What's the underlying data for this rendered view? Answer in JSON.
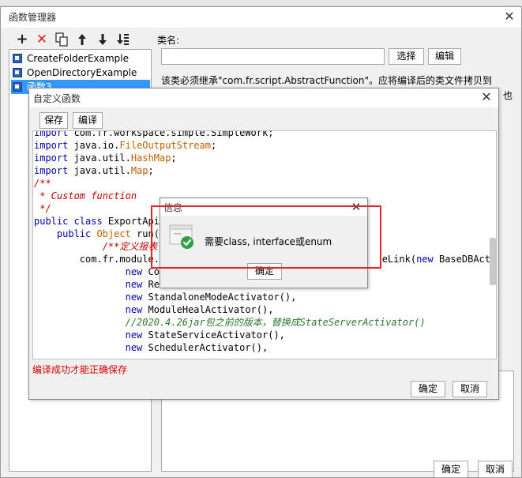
{
  "main": {
    "title": "函数管理器",
    "toolbar_icons": [
      "add-icon",
      "delete-icon",
      "copy-icon",
      "move-up-icon",
      "move-down-icon",
      "sort-icon"
    ],
    "list_items": [
      "CreateFolderExample",
      "OpenDirectoryExample",
      "函数3"
    ],
    "class_label": "类名:",
    "class_value": "",
    "select_label": "选择",
    "edit_label": "编辑",
    "description": "该类必须继承\"com.fr.script.AbstractFunction\"。应将编译后的类文件拷贝到",
    "description_tail": "也",
    "ok_label": "确定",
    "cancel_label": "取消"
  },
  "custom": {
    "title": "自定义函数",
    "save_label": "保存",
    "compile_label": "编译",
    "code_lines": [
      {
        "parts": [
          [
            "kw",
            "import"
          ],
          [
            "",
            " com.fr.workspace.simple.SimpleWork;"
          ]
        ]
      },
      {
        "parts": [
          [
            "kw",
            "import"
          ],
          [
            "",
            " java.io."
          ],
          [
            "cls",
            "FileOutputStream"
          ],
          [
            "",
            ";"
          ]
        ]
      },
      {
        "parts": [
          [
            "kw",
            "import"
          ],
          [
            "",
            " java.util."
          ],
          [
            "cls",
            "HashMap"
          ],
          [
            "",
            ";"
          ]
        ]
      },
      {
        "parts": [
          [
            "kw",
            "import"
          ],
          [
            "",
            " java.util."
          ],
          [
            "cls",
            "Map"
          ],
          [
            "",
            ";"
          ]
        ]
      },
      {
        "parts": [
          [
            "cm",
            "/**"
          ]
        ]
      },
      {
        "parts": [
          [
            "cm",
            " * Custom function"
          ]
        ]
      },
      {
        "parts": [
          [
            "cm",
            " */"
          ]
        ]
      },
      {
        "parts": [
          [
            "kw",
            "public class"
          ],
          [
            "",
            " ExportApi"
          ]
        ]
      },
      {
        "parts": [
          [
            "",
            "    "
          ],
          [
            "kw",
            "public"
          ],
          [
            "",
            " "
          ],
          [
            "cls",
            "Object"
          ],
          [
            "",
            " run("
          ],
          [
            "cls",
            "O"
          ]
        ]
      },
      {
        "parts": [
          [
            "",
            "            "
          ],
          [
            "cm",
            "/**定义报表"
          ]
        ]
      },
      {
        "parts": [
          [
            "",
            "        com.fr.module.M"
          ],
          [
            "",
            "                                      eLink("
          ],
          [
            "nw",
            "new"
          ],
          [
            "",
            " BaseDBActiva"
          ]
        ]
      },
      {
        "parts": [
          [
            "",
            "                "
          ],
          [
            "nw",
            "new"
          ],
          [
            "",
            " Con"
          ]
        ]
      },
      {
        "parts": [
          [
            "",
            "                "
          ],
          [
            "nw",
            "new"
          ],
          [
            "",
            " Res"
          ]
        ]
      },
      {
        "parts": [
          [
            "",
            "                "
          ],
          [
            "nw",
            "new"
          ],
          [
            "",
            " StandaloneModeActivator(),"
          ]
        ]
      },
      {
        "parts": [
          [
            "",
            "                "
          ],
          [
            "nw",
            "new"
          ],
          [
            "",
            " ModuleHealActivator(),"
          ]
        ]
      },
      {
        "parts": [
          [
            "",
            "                "
          ],
          [
            "cmg",
            "//2020.4.26jar包之前的版本，替换成StateServerActivator()"
          ]
        ]
      },
      {
        "parts": [
          [
            "",
            "                "
          ],
          [
            "nw",
            "new"
          ],
          [
            "",
            " StateServiceActivator(),"
          ]
        ]
      },
      {
        "parts": [
          [
            "",
            "                "
          ],
          [
            "nw",
            "new"
          ],
          [
            "",
            " SchedulerActivator(),"
          ]
        ]
      }
    ],
    "compile_message": "编译成功才能正确保存",
    "ok_label": "确定",
    "cancel_label": "取消"
  },
  "info": {
    "title": "信息",
    "message": "需要class, interface或enum",
    "ok_label": "确定",
    "icon": "success-check-icon",
    "icon_color": "#2ea043",
    "highlight_color": "#e0262b"
  }
}
